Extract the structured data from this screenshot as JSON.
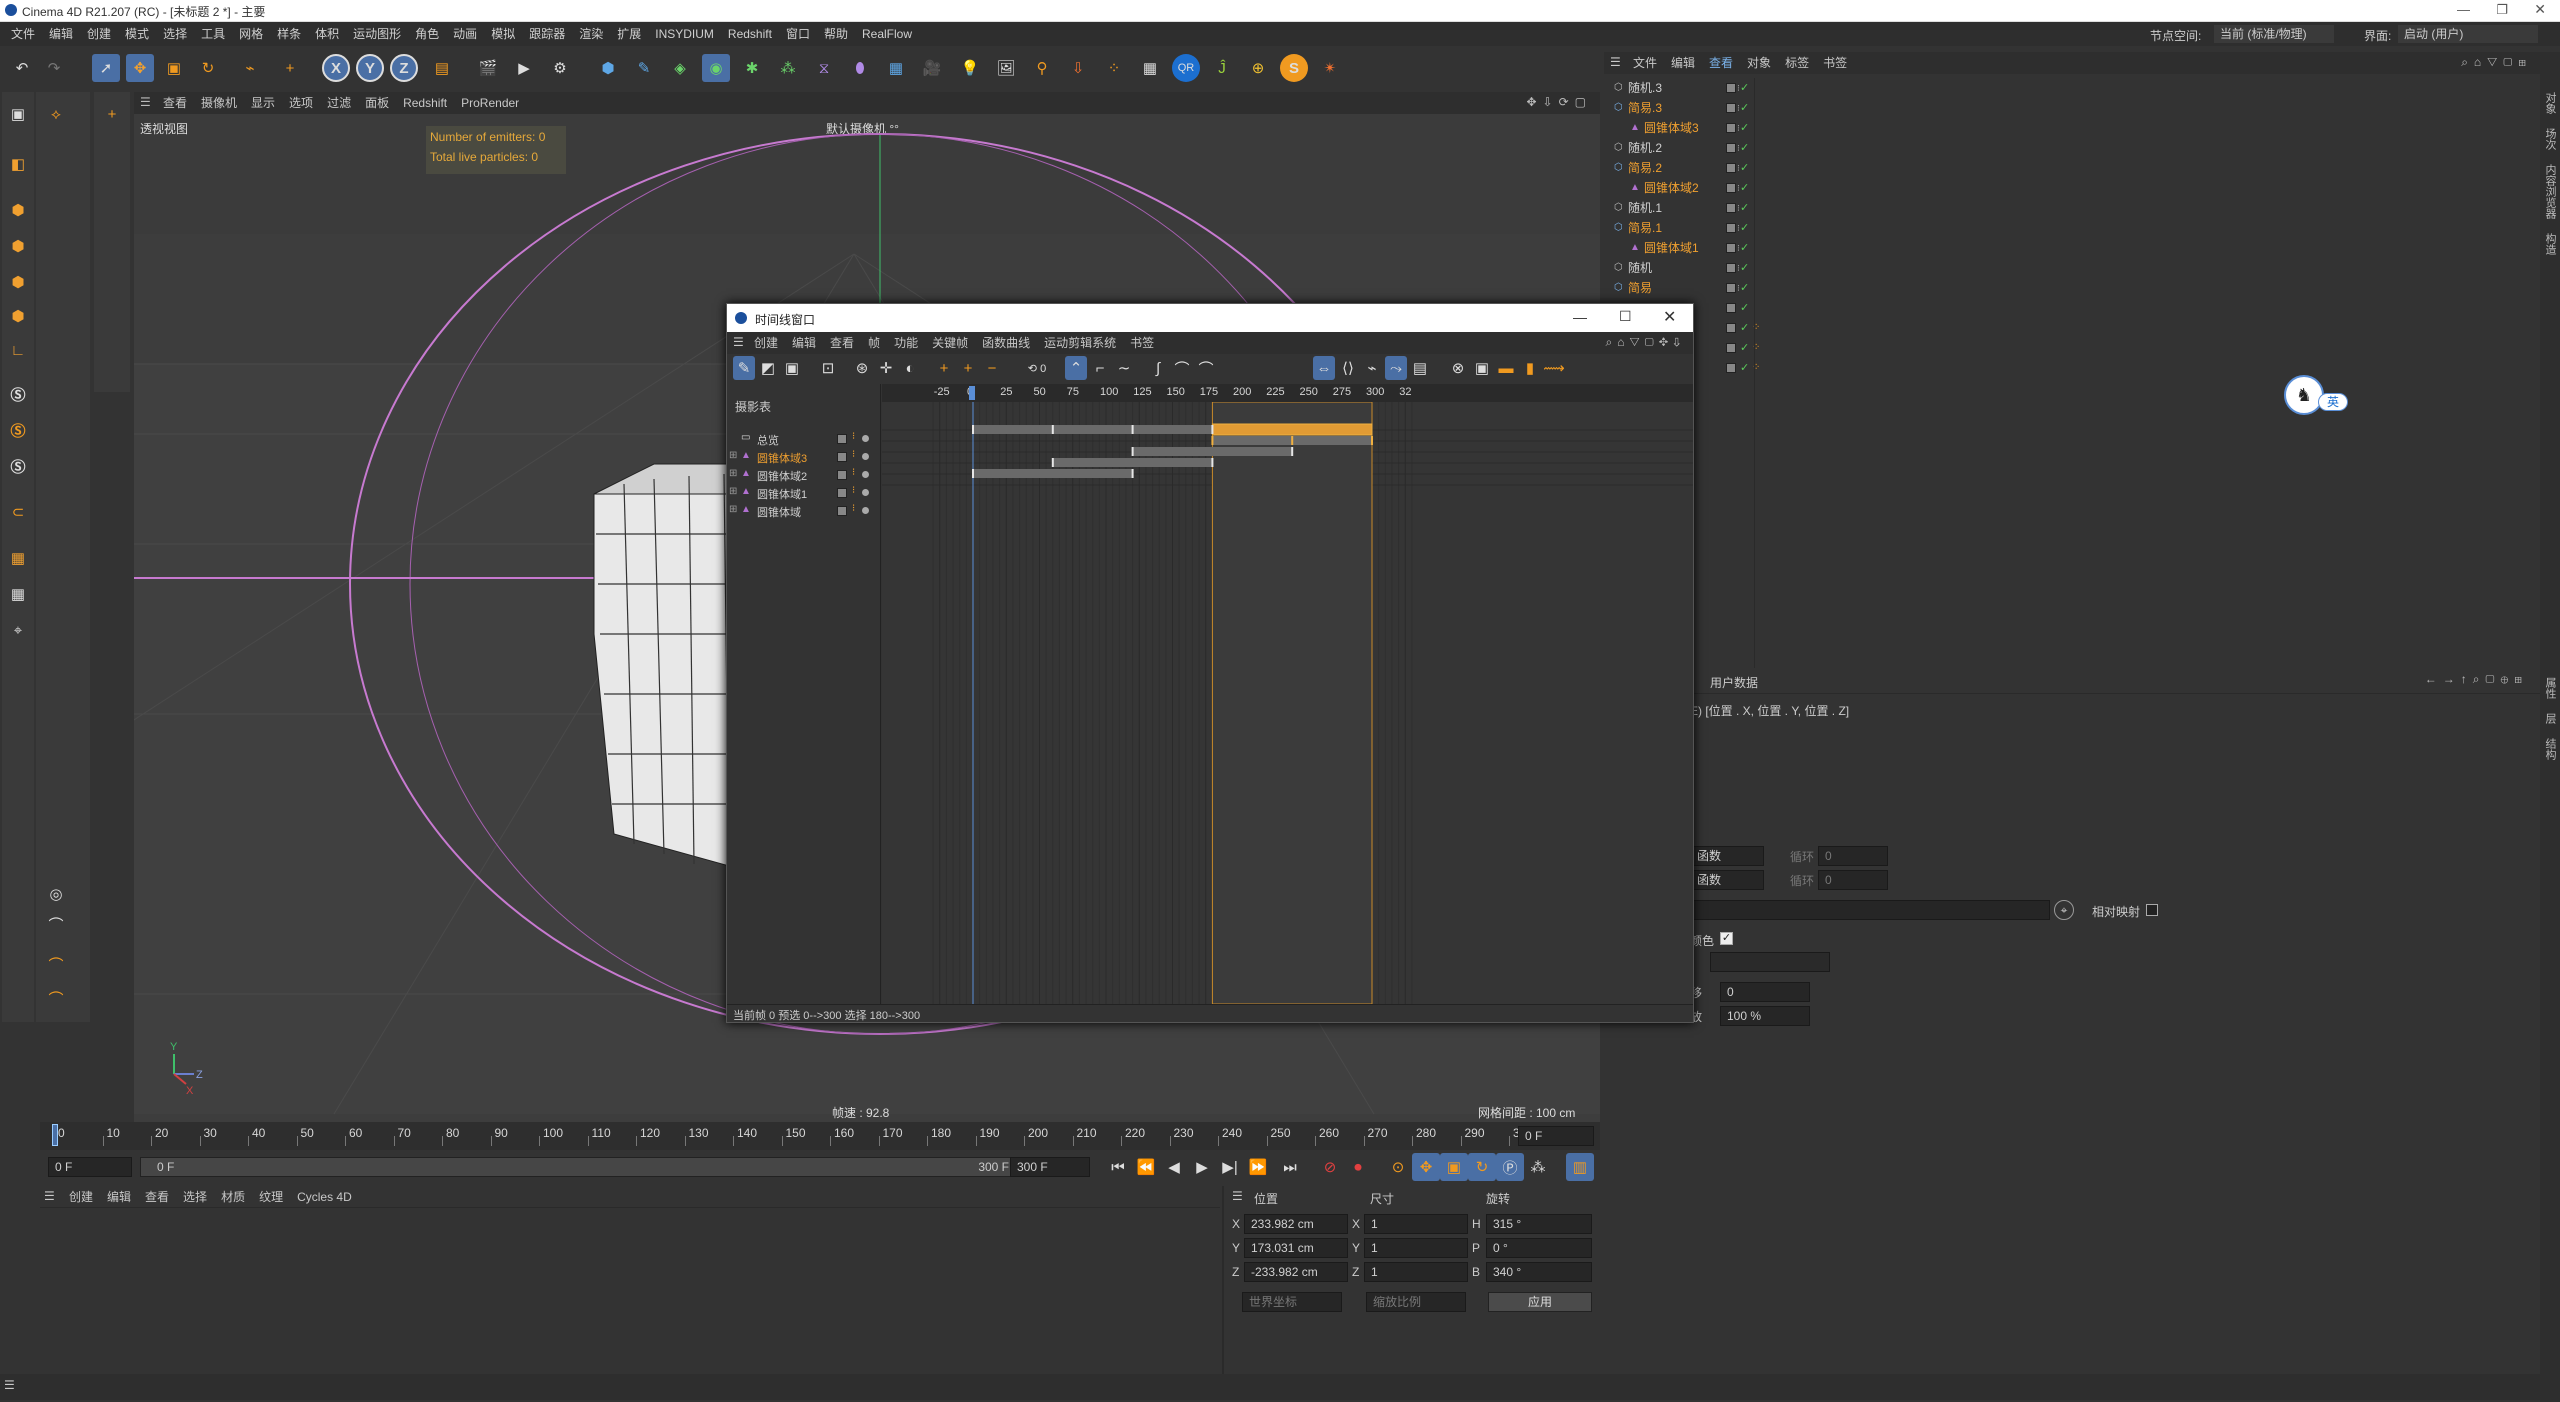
{
  "window": {
    "title": "Cinema 4D R21.207 (RC) - [未标题 2 *] - 主要"
  },
  "main_menu": [
    "文件",
    "编辑",
    "创建",
    "模式",
    "选择",
    "工具",
    "网格",
    "样条",
    "体积",
    "运动图形",
    "角色",
    "动画",
    "模拟",
    "跟踪器",
    "渲染",
    "扩展",
    "INSYDIUM",
    "Redshift",
    "窗口",
    "帮助",
    "RealFlow"
  ],
  "node_space": {
    "label": "节点空间:",
    "value": "当前 (标准/物理)"
  },
  "interface": {
    "label": "界面:",
    "value": "启动 (用户)"
  },
  "viewport": {
    "menu": [
      "查看",
      "摄像机",
      "显示",
      "选项",
      "过滤",
      "面板",
      "Redshift",
      "ProRender"
    ],
    "view_name": "透视视图",
    "camera_name": "默认摄像机 °°",
    "emitters": "Number of emitters: 0",
    "particles": "Total live particles: 0",
    "fps": "帧速 : 92.8",
    "grid": "网格间距 : 100 cm"
  },
  "object_manager": {
    "menu": [
      "文件",
      "编辑",
      "查看",
      "对象",
      "标签",
      "书签"
    ],
    "items": [
      {
        "name": "随机.3",
        "type": "random"
      },
      {
        "name": "简易.3",
        "type": "plain",
        "orange": true
      },
      {
        "name": "圆锥体域3",
        "type": "field",
        "orange": true
      },
      {
        "name": "随机.2",
        "type": "random"
      },
      {
        "name": "简易.2",
        "type": "plain",
        "orange": true
      },
      {
        "name": "圆锥体域2",
        "type": "field",
        "orange": true
      },
      {
        "name": "随机.1",
        "type": "random"
      },
      {
        "name": "简易.1",
        "type": "plain",
        "orange": true
      },
      {
        "name": "圆锥体域1",
        "type": "field",
        "orange": true
      },
      {
        "name": "随机",
        "type": "random"
      },
      {
        "name": "简易",
        "type": "plain",
        "orange": true
      }
    ]
  },
  "timeline_window": {
    "title": "时间线窗口",
    "menu": [
      "创建",
      "编辑",
      "查看",
      "帧",
      "功能",
      "关键帧",
      "函数曲线",
      "运动剪辑系统",
      "书签"
    ],
    "panel_label": "摄影表",
    "tracks": [
      {
        "name": "总览",
        "icon": "folder"
      },
      {
        "name": "圆锥体域3",
        "icon": "cone",
        "orange": true
      },
      {
        "name": "圆锥体域2",
        "icon": "cone"
      },
      {
        "name": "圆锥体域1",
        "icon": "cone"
      },
      {
        "name": "圆锥体域",
        "icon": "cone"
      }
    ],
    "ruler": [
      "-25",
      "0",
      "25",
      "50",
      "75",
      "100",
      "125",
      "150",
      "175",
      "200",
      "225",
      "250",
      "275",
      "300",
      "32"
    ],
    "status": "当前帧  0  预选  0-->300   选择 180-->300"
  },
  "attributes": {
    "header": "用户数据",
    "vector_text": "E) [位置 . X, 位置 . Y, 位置 . Z]",
    "drop1": "函数",
    "drop2": "函数",
    "loop1_label": "循环",
    "loop1_value": "0",
    "loop2_label": "循环",
    "loop2_value": "0",
    "relative_label": "相对映射",
    "color_label": "颜色",
    "field_a_label": "移",
    "field_a_value": "0",
    "field_b_label": "放",
    "field_b_value": "100 %"
  },
  "ime": {
    "label": "英"
  },
  "main_timeline": {
    "ticks": [
      "0",
      "10",
      "20",
      "30",
      "40",
      "50",
      "60",
      "70",
      "80",
      "90",
      "100",
      "110",
      "120",
      "130",
      "140",
      "150",
      "160",
      "170",
      "180",
      "190",
      "200",
      "210",
      "220",
      "230",
      "240",
      "250",
      "260",
      "270",
      "280",
      "290",
      "300"
    ],
    "current_frame_field": "0 F",
    "start_field": "0 F",
    "range_start": "0 F",
    "range_end": "300 F",
    "end_field": "300 F"
  },
  "material_manager": {
    "menu": [
      "创建",
      "编辑",
      "查看",
      "选择",
      "材质",
      "纹理",
      "Cycles 4D"
    ]
  },
  "coordinates": {
    "headers": [
      "位置",
      "尺寸",
      "旋转"
    ],
    "rows": [
      {
        "pos_label": "X",
        "pos": "233.982 cm",
        "size_label": "X",
        "size": "1",
        "rot_label": "H",
        "rot": "315 °"
      },
      {
        "pos_label": "Y",
        "pos": "173.031 cm",
        "size_label": "Y",
        "size": "1",
        "rot_label": "P",
        "rot": "0 °"
      },
      {
        "pos_label": "Z",
        "pos": "-233.982 cm",
        "size_label": "Z",
        "size": "1",
        "rot_label": "B",
        "rot": "340 °"
      }
    ],
    "mode1": "世界坐标",
    "mode2": "缩放比例",
    "apply": "应用"
  },
  "side_tabs": [
    "对象",
    "场次",
    "内容浏览器",
    "构造"
  ],
  "attr_side_tabs": [
    "属性",
    "层",
    "结构"
  ]
}
